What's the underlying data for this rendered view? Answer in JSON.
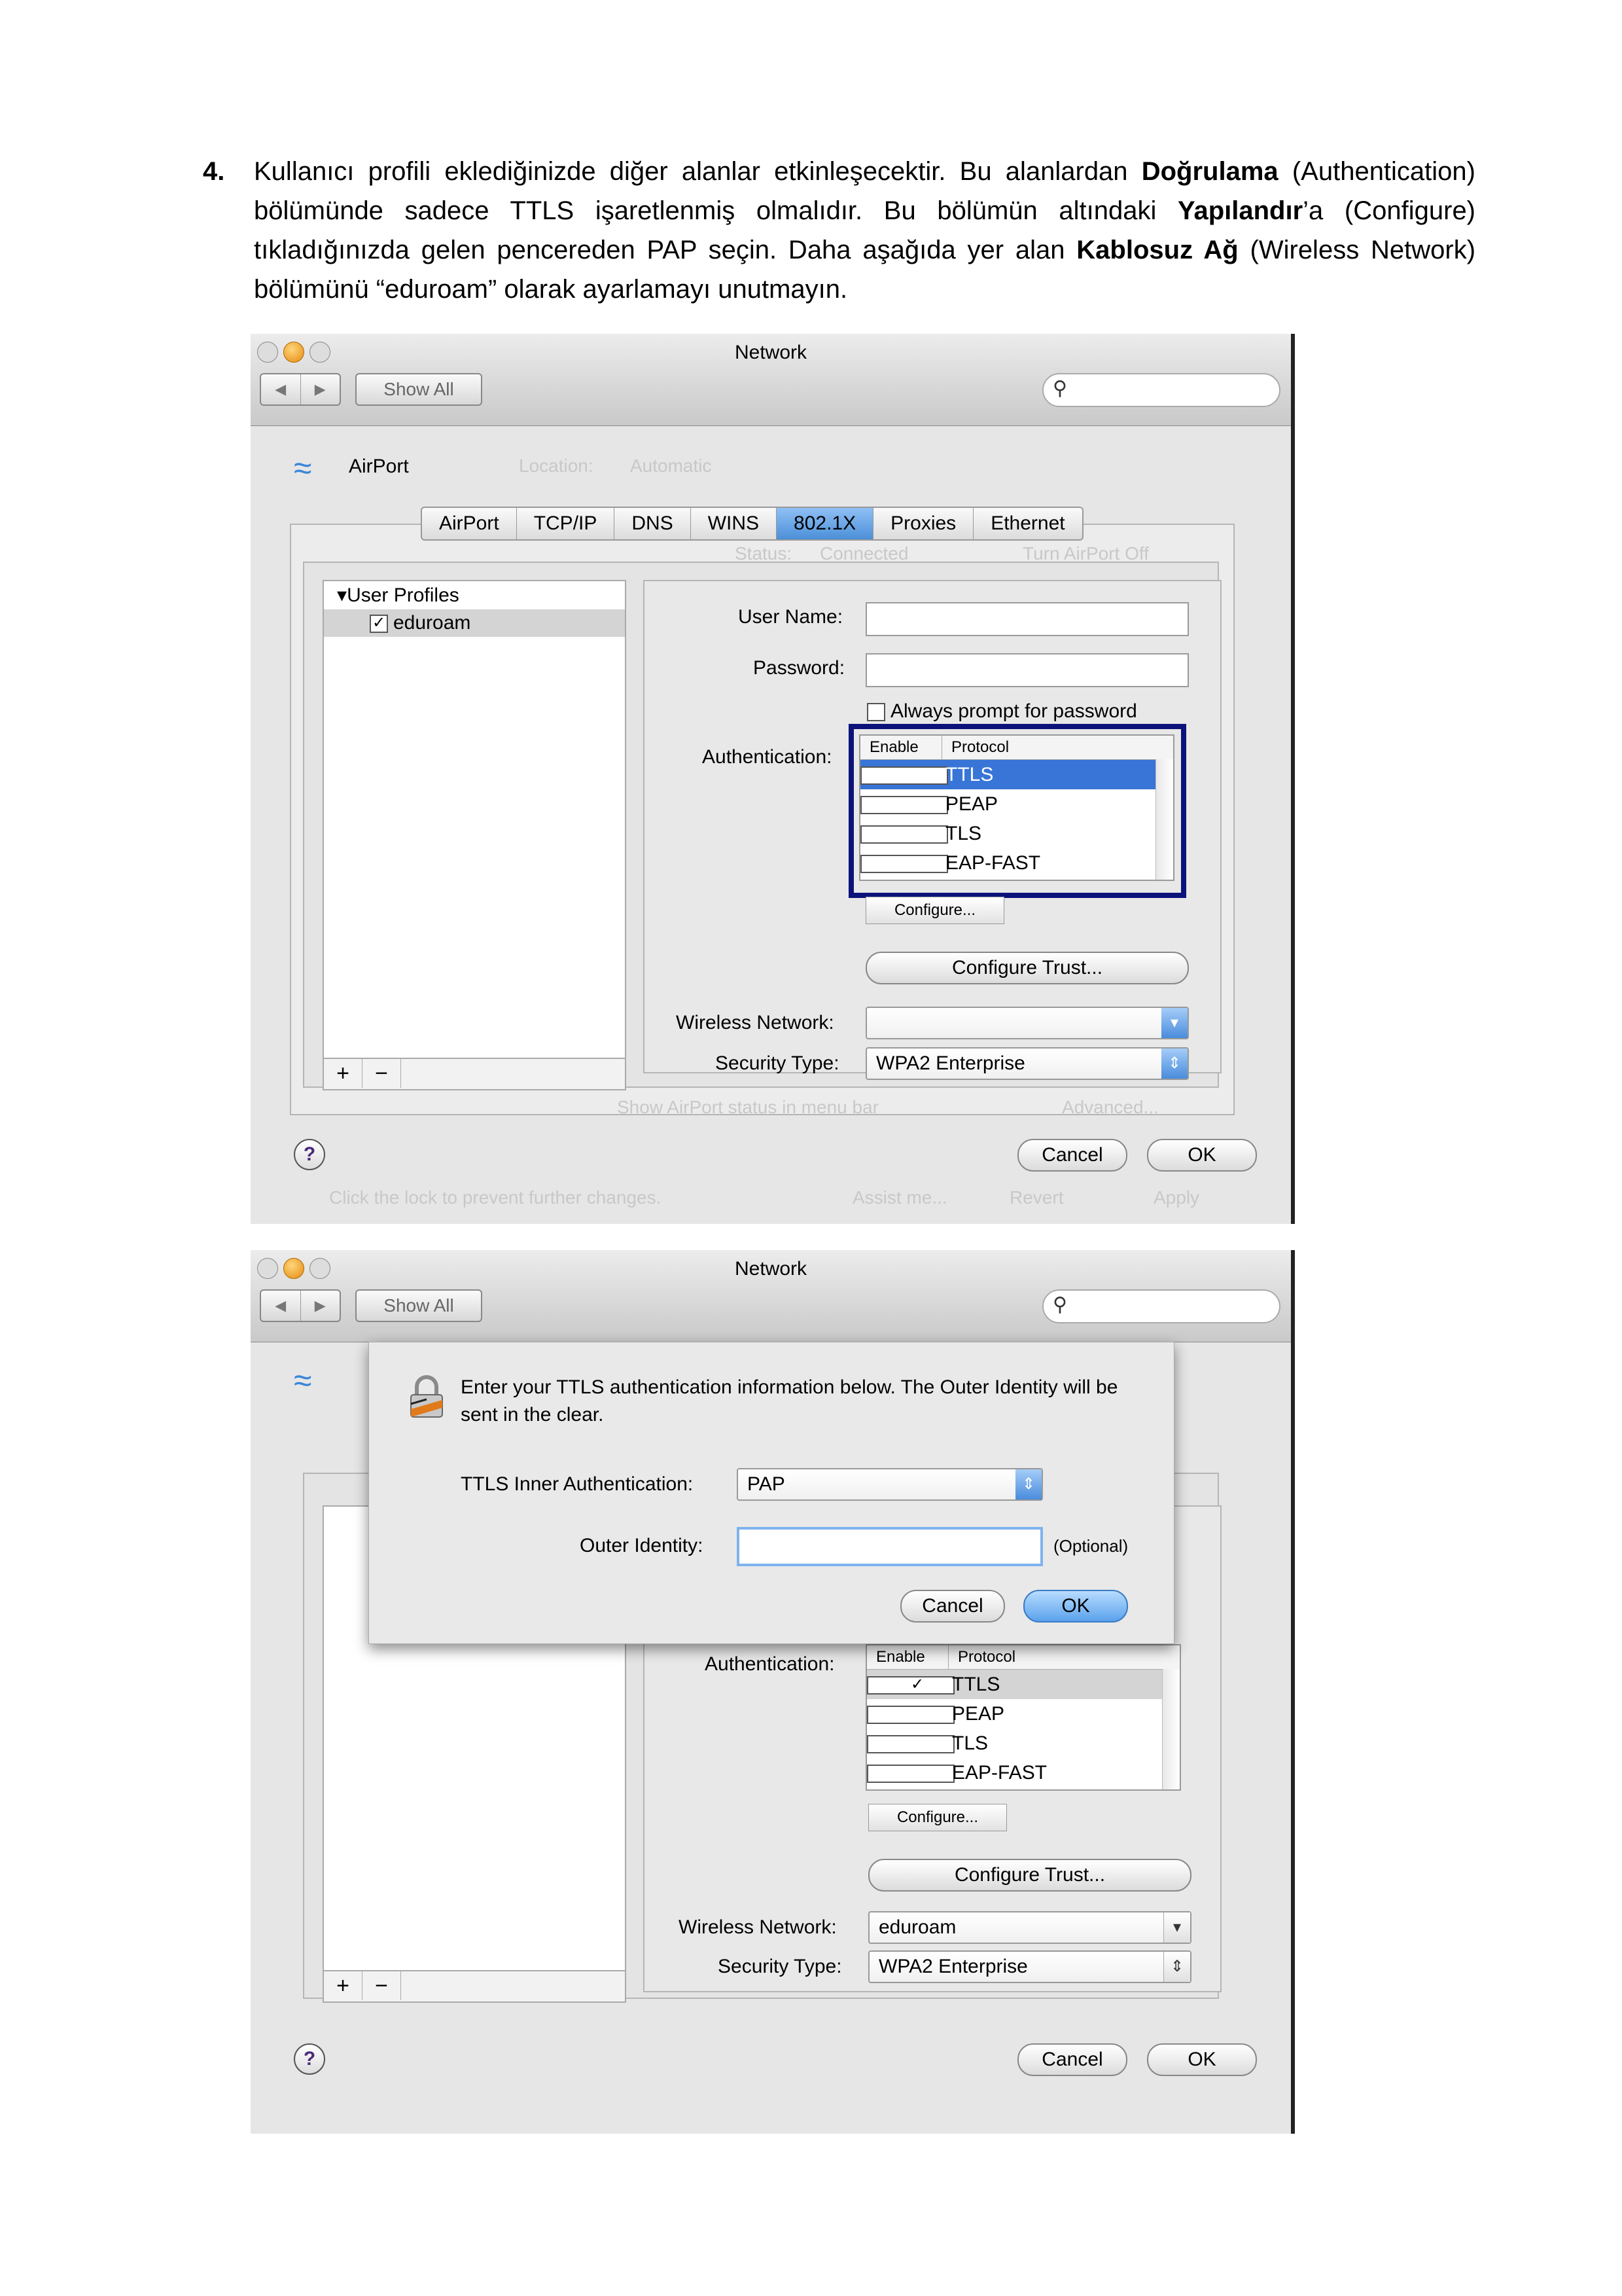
{
  "instruction": {
    "number": "4.",
    "parts": [
      {
        "t": "Kullanıcı profili eklediğinizde diğer alanlar etkinleşecektir. Bu alanlardan ",
        "b": false
      },
      {
        "t": "Doğrulama",
        "b": true
      },
      {
        "t": " (Authentication) bölümünde sadece TTLS işaretlenmiş olmalıdır. Bu bölümün altındaki ",
        "b": false
      },
      {
        "t": "Yapılandır",
        "b": true
      },
      {
        "t": "’a (Configure) tıkladığınızda gelen pencereden PAP seçin. Daha aşağıda yer alan ",
        "b": false
      },
      {
        "t": "Kablosuz Ağ",
        "b": true
      },
      {
        "t": " (Wireless Network) bölümünü “eduroam” olarak ayarlamayı unutmayın.",
        "b": false
      }
    ]
  },
  "shot1": {
    "window_title": "Network",
    "show_all": "Show All",
    "interface_name": "AirPort",
    "bg_location_label": "Location:",
    "bg_location_value": "Automatic",
    "bg_status_label": "Status:",
    "bg_status_value": "Connected",
    "bg_turn_off": "Turn AirPort Off",
    "tabs": [
      "AirPort",
      "TCP/IP",
      "DNS",
      "WINS",
      "802.1X",
      "Proxies",
      "Ethernet"
    ],
    "selected_tab": "802.1X",
    "profiles_header": "User Profiles",
    "profile_name": "eduroam",
    "user_name_label": "User Name:",
    "password_label": "Password:",
    "always_prompt": "Always prompt for password",
    "authentication_label": "Authentication:",
    "table_headers": [
      "Enable",
      "Protocol"
    ],
    "protocols": [
      {
        "enabled": true,
        "name": "TTLS"
      },
      {
        "enabled": false,
        "name": "PEAP"
      },
      {
        "enabled": false,
        "name": "TLS"
      },
      {
        "enabled": false,
        "name": "EAP-FAST"
      }
    ],
    "configure_button": "Configure...",
    "configure_trust_button": "Configure Trust...",
    "wireless_network_label": "Wireless Network:",
    "wireless_network_value": "",
    "security_type_label": "Security Type:",
    "security_type_value": "WPA2 Enterprise",
    "bg_show_status": "Show AirPort status in menu bar",
    "bg_advanced": "Advanced...",
    "cancel": "Cancel",
    "ok": "OK",
    "bg_lock_text": "Click the lock to prevent further changes.",
    "bg_assist": "Assist me...",
    "bg_revert": "Revert",
    "bg_apply": "Apply"
  },
  "shot2": {
    "window_title": "Network",
    "show_all": "Show All",
    "sheet_message": "Enter your TTLS authentication information below. The Outer Identity will be sent in the clear.",
    "inner_auth_label": "TTLS Inner Authentication:",
    "inner_auth_value": "PAP",
    "outer_identity_label": "Outer Identity:",
    "outer_identity_value": "",
    "optional": "(Optional)",
    "sheet_cancel": "Cancel",
    "sheet_ok": "OK",
    "authentication_label": "Authentication:",
    "table_headers": [
      "Enable",
      "Protocol"
    ],
    "protocols": [
      {
        "enabled": true,
        "name": "TTLS"
      },
      {
        "enabled": false,
        "name": "PEAP"
      },
      {
        "enabled": false,
        "name": "TLS"
      },
      {
        "enabled": false,
        "name": "EAP-FAST"
      }
    ],
    "configure_button": "Configure...",
    "configure_trust_button": "Configure Trust...",
    "wireless_network_label": "Wireless Network:",
    "wireless_network_value": "eduroam",
    "security_type_label": "Security Type:",
    "security_type_value": "WPA2 Enterprise",
    "cancel": "Cancel",
    "ok": "OK"
  }
}
